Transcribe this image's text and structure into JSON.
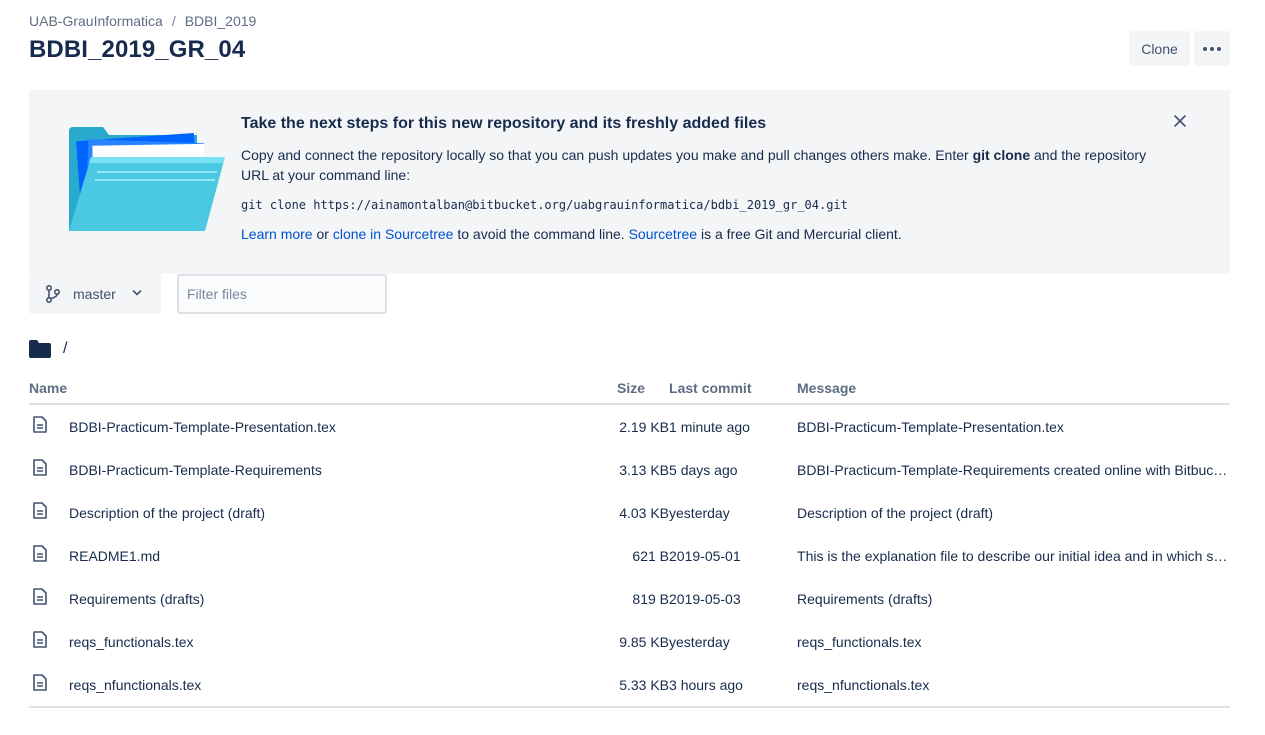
{
  "breadcrumb": {
    "workspace": "UAB-GrauInformatica",
    "separator": "/",
    "project": "BDBI_2019"
  },
  "page_title": "BDBI_2019_GR_04",
  "actions": {
    "clone_label": "Clone",
    "more_icon": "more-horizontal-icon"
  },
  "banner": {
    "title": "Take the next steps for this new repository and its freshly added files",
    "desc_before": "Copy and connect the repository locally so that you can push updates you make and pull changes others make. Enter ",
    "desc_bold": "git clone",
    "desc_after": " and the repository URL at your command line:",
    "command": "git clone https://ainamontalban@bitbucket.org/uabgrauinformatica/bdbi_2019_gr_04.git",
    "learn_more": "Learn more",
    "or_text": " or ",
    "clone_sourcetree": "clone in Sourcetree",
    "avoid_text": " to avoid the command line. ",
    "sourcetree": "Sourcetree",
    "client_text": " is a free Git and Mercurial client.",
    "close_icon": "close-icon"
  },
  "branch": {
    "name": "master",
    "icon": "branch-icon"
  },
  "filter": {
    "placeholder": "Filter files"
  },
  "path": {
    "separator": "/",
    "icon": "folder-icon"
  },
  "table": {
    "headers": {
      "name": "Name",
      "size": "Size",
      "last_commit": "Last commit",
      "message": "Message"
    },
    "rows": [
      {
        "name": "BDBI-Practicum-Template-Presentation.tex",
        "size": "2.19 KB",
        "last_commit": "1 minute ago",
        "message": "BDBI-Practicum-Template-Presentation.tex"
      },
      {
        "name": "BDBI-Practicum-Template-Requirements",
        "size": "3.13 KB",
        "last_commit": "5 days ago",
        "message": "BDBI-Practicum-Template-Requirements created online with Bitbucket"
      },
      {
        "name": "Description of the project (draft)",
        "size": "4.03 KB",
        "last_commit": "yesterday",
        "message": "Description of the project (draft)"
      },
      {
        "name": "README1.md",
        "size": "621 B",
        "last_commit": "2019-05-01",
        "message": "This is the explanation file to describe our initial idea and in which steps we will proceed"
      },
      {
        "name": "Requirements (drafts)",
        "size": "819 B",
        "last_commit": "2019-05-03",
        "message": "Requirements (drafts)"
      },
      {
        "name": "reqs_functionals.tex",
        "size": "9.85 KB",
        "last_commit": "yesterday",
        "message": "reqs_functionals.tex"
      },
      {
        "name": "reqs_nfunctionals.tex",
        "size": "5.33 KB",
        "last_commit": "3 hours ago",
        "message": "reqs_nfunctionals.tex"
      }
    ]
  },
  "colors": {
    "link": "#0052cc",
    "text": "#172b4d",
    "banner_bg": "#f4f5f7",
    "folder_art": "#4bc8e2"
  }
}
